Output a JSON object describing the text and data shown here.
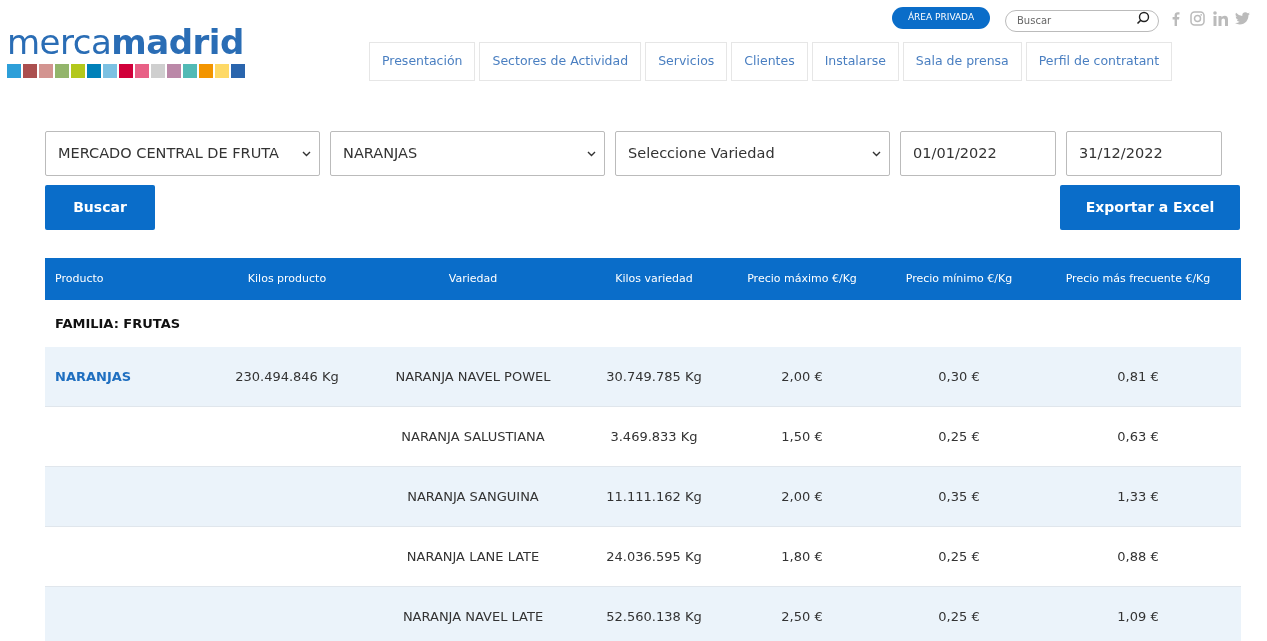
{
  "logo": {
    "text": "merca**madrid**"
  },
  "top_bar": {
    "private_area": "ÁREA PRIVADA",
    "search": {
      "placeholder": "Buscar"
    }
  },
  "nav": [
    {
      "label": "Presentación"
    },
    {
      "label": "Sectores de Actividad"
    },
    {
      "label": "Servicios"
    },
    {
      "label": "Clientes"
    },
    {
      "label": "Instalarse"
    },
    {
      "label": "Sala de prensa"
    },
    {
      "label": "Perfil de contratant"
    }
  ],
  "filters": [
    {
      "kind": "select",
      "value": "MERCADO CENTRAL DE FRUTA"
    },
    {
      "kind": "select",
      "value": "NARANJAS"
    },
    {
      "kind": "select",
      "value": "Seleccione Variedad"
    },
    {
      "kind": "date",
      "value": "01/01/2022"
    },
    {
      "kind": "date",
      "value": "31/12/2022"
    }
  ],
  "buttons": {
    "search": "Buscar",
    "export": "Exportar a Excel"
  },
  "table": {
    "columns": [
      "Producto",
      "Kilos producto",
      "Variedad",
      "Kilos variedad",
      "Precio máximo €/Kg",
      "Precio mínimo €/Kg",
      "Precio más frecuente €/Kg"
    ],
    "family": "FAMILIA: FRUTAS",
    "rows": [
      {
        "product": "NARANJAS",
        "product_kilos": "230.494.846 Kg",
        "variety": "NARANJA NAVEL POWEL",
        "variety_kilos": "30.749.785 Kg",
        "max": "2,00 €",
        "min": "0,30 €",
        "frequent": "0,81 €"
      },
      {
        "variety": "NARANJA SALUSTIANA",
        "variety_kilos": "3.469.833 Kg",
        "max": "1,50 €",
        "min": "0,25 €",
        "frequent": "0,63 €"
      },
      {
        "variety": "NARANJA SANGUINA",
        "variety_kilos": "11.111.162 Kg",
        "max": "2,00 €",
        "min": "0,35 €",
        "frequent": "1,33 €"
      },
      {
        "variety": "NARANJA LANE LATE",
        "variety_kilos": "24.036.595 Kg",
        "max": "1,80 €",
        "min": "0,25 €",
        "frequent": "0,88 €"
      },
      {
        "variety": "NARANJA NAVEL LATE",
        "variety_kilos": "52.560.138 Kg",
        "max": "2,50 €",
        "min": "0,25 €",
        "frequent": "1,09 €"
      }
    ]
  }
}
